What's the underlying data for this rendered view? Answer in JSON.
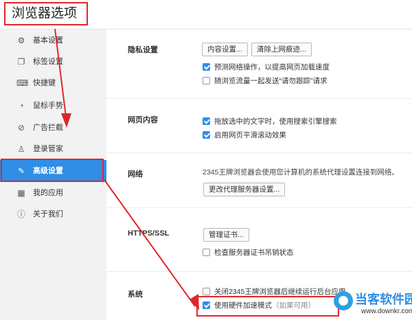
{
  "header": {
    "title": "浏览器选项"
  },
  "sidebar": {
    "items": [
      {
        "label": "基本设置",
        "icon": "gear-icon",
        "glyph": "⚙"
      },
      {
        "label": "标签设置",
        "icon": "tabs-icon",
        "glyph": "❐"
      },
      {
        "label": "快捷键",
        "icon": "keyboard-icon",
        "glyph": "⌨"
      },
      {
        "label": "鼠标手势",
        "icon": "mouse-icon",
        "glyph": "◔"
      },
      {
        "label": "广告拦截",
        "icon": "block-icon",
        "glyph": "⊘"
      },
      {
        "label": "登录管家",
        "icon": "user-icon",
        "glyph": "♙"
      },
      {
        "label": "高级设置",
        "icon": "wrench-icon",
        "glyph": "✎",
        "active": true
      },
      {
        "label": "我的应用",
        "icon": "apps-icon",
        "glyph": "▦"
      },
      {
        "label": "关于我们",
        "icon": "info-icon",
        "glyph": "ⓘ"
      }
    ]
  },
  "privacy": {
    "title": "隐私设置",
    "content_settings_button": "内容设置...",
    "clear_history_button": "清除上网痕迹...",
    "options": [
      {
        "label": "预测网络操作，以提高网页加载速度",
        "checked": true
      },
      {
        "label": "随浏览流量一起发送“请勿跟踪”请求",
        "checked": false
      }
    ]
  },
  "web_content": {
    "title": "网页内容",
    "options": [
      {
        "label": "拖放选中的文字时，使用搜索引擎搜索",
        "checked": true
      },
      {
        "label": "启用网页平滑滚动效果",
        "checked": true
      }
    ]
  },
  "network": {
    "title": "网络",
    "description": "2345王牌浏览器会使用您计算机的系统代理设置连接到网络。",
    "proxy_button": "更改代理服务器设置..."
  },
  "https": {
    "title": "HTTPS/SSL",
    "manage_certs_button": "管理证书...",
    "options": [
      {
        "label": "检查服务器证书吊销状态",
        "checked": false
      }
    ]
  },
  "system": {
    "title": "系统",
    "options": [
      {
        "label": "关闭2345王牌浏览器后继续运行后台应用",
        "checked": false
      },
      {
        "label": "使用硬件加速模式",
        "hint": "（如果可用）",
        "checked": true
      }
    ]
  },
  "watermark": {
    "main": "当客软件园",
    "sub": "www.downkr.com"
  },
  "colors": {
    "accent": "#2e8ee8",
    "highlight": "#e0262a",
    "sidebar_bg": "#f2f2f2"
  }
}
